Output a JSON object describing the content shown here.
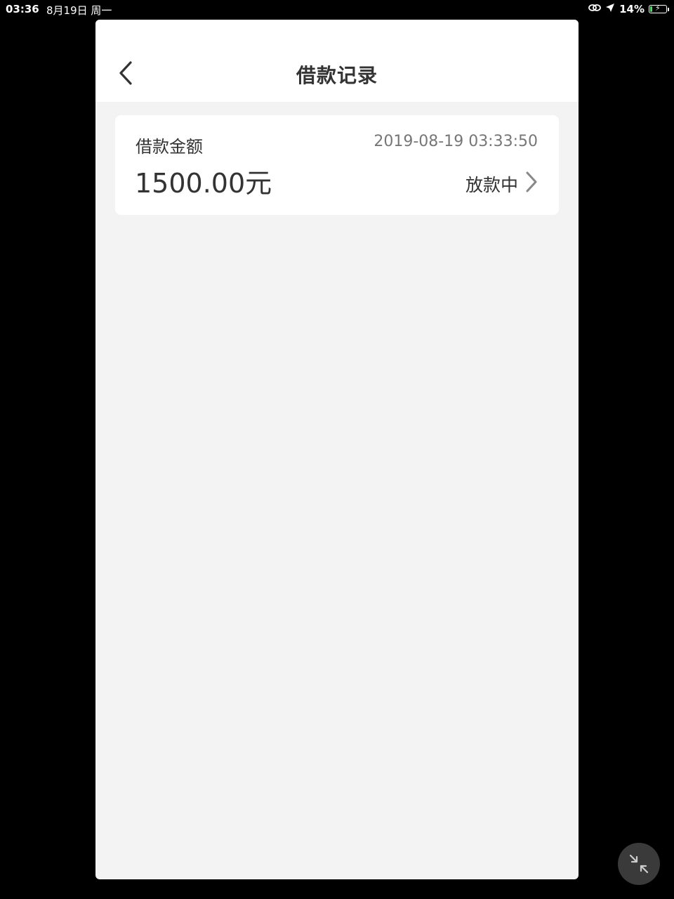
{
  "status_bar": {
    "time": "03:36",
    "date": "8月19日 周一",
    "battery_percent": "14%",
    "battery_level": 0.14,
    "icons": [
      "link-icon",
      "location-arrow-icon",
      "battery-charging-icon"
    ]
  },
  "nav": {
    "title": "借款记录",
    "back_icon": "chevron-left-icon"
  },
  "records": [
    {
      "amount_label": "借款金额",
      "time": "2019-08-19 03:33:50",
      "amount": "1500.00元",
      "status": "放款中",
      "status_icon": "chevron-right-icon"
    }
  ],
  "floating_button": {
    "icon": "minimize-arrows-icon"
  },
  "colors": {
    "background": "#000000",
    "page": "#f3f3f3",
    "card": "#ffffff",
    "text_primary": "#333333",
    "text_secondary": "#777777",
    "battery_fill": "#4cd964"
  }
}
